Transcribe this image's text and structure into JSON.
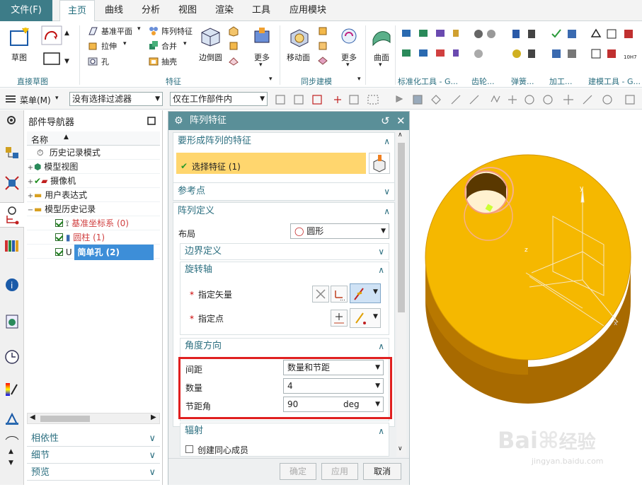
{
  "menubar": {
    "file": "文件(F)",
    "tabs": [
      "主页",
      "曲线",
      "分析",
      "视图",
      "渲染",
      "工具",
      "应用模块"
    ]
  },
  "ribbon": {
    "sketch": "草图",
    "direct_sketch": "直接草图",
    "datum_plane": "基准平面",
    "extrude": "拉伸",
    "hole": "孔",
    "pattern_feature": "阵列特征",
    "unite": "合并",
    "shell": "抽壳",
    "edge_blend": "边倒圆",
    "more": "更多",
    "feature_group": "特征",
    "move_face": "移动面",
    "more2": "更多",
    "sync_group": "同步建模",
    "surface": "曲面",
    "std_tools": "标准化工具 - G...",
    "gear": "齿轮...",
    "spring": "弹簧...",
    "machining": "加工...",
    "build_tools": "建模工具 - G..."
  },
  "toolbar2": {
    "menu": "菜单(M)",
    "filter": "没有选择过滤器",
    "scope": "仅在工作部件内"
  },
  "navigator": {
    "title": "部件导航器",
    "col_name": "名称",
    "rows": [
      "历史记录模式",
      "模型视图",
      "摄像机",
      "用户表达式",
      "模型历史记录",
      "基准坐标系 (0)",
      "圆柱 (1)",
      "简单孔 (2)"
    ],
    "sections": [
      "相依性",
      "细节",
      "预览"
    ]
  },
  "dialog": {
    "title": "阵列特征",
    "sec_features": "要形成阵列的特征",
    "select_feature": "选择特征 (1)",
    "ref_point": "参考点",
    "pattern_def": "阵列定义",
    "layout_label": "布局",
    "layout_value": "圆形",
    "boundary": "边界定义",
    "rot_axis": "旋转轴",
    "spec_vector": "指定矢量",
    "spec_point": "指定点",
    "angle_dir": "角度方向",
    "spacing_label": "间距",
    "spacing_value": "数量和节距",
    "count_label": "数量",
    "count_value": "4",
    "pitch_label": "节距角",
    "pitch_value": "90",
    "pitch_unit": "deg",
    "radiation": "辐射",
    "create_concentric": "创建同心成员",
    "ok": "确定",
    "apply": "应用",
    "cancel": "取消"
  },
  "watermark": {
    "brand": "Bai",
    "brand2": "经验",
    "url": "jingyan.baidu.com"
  },
  "colors": {
    "accent": "#3d7c88",
    "highlight": "#ffd66e",
    "selection_box": "#e02020",
    "part": "#f5b800"
  }
}
